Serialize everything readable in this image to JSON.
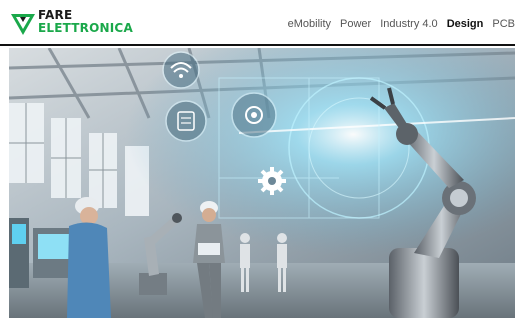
{
  "header": {
    "logo": {
      "line1": "FARE",
      "line2": "ELETTRONICA"
    },
    "nav": [
      {
        "label": "eMobility",
        "active": false
      },
      {
        "label": "Power",
        "active": false
      },
      {
        "label": "Industry 4.0",
        "active": false
      },
      {
        "label": "Design",
        "active": true
      },
      {
        "label": "PCB",
        "active": false
      }
    ]
  },
  "hero": {
    "icons": [
      "wifi-icon",
      "checklist-icon",
      "settings-icon",
      "gear-icon"
    ]
  },
  "colors": {
    "brand_green": "#1aa84a",
    "text_dark": "#111111",
    "nav_text": "#555555",
    "hero_glow": "#7fdcff"
  }
}
